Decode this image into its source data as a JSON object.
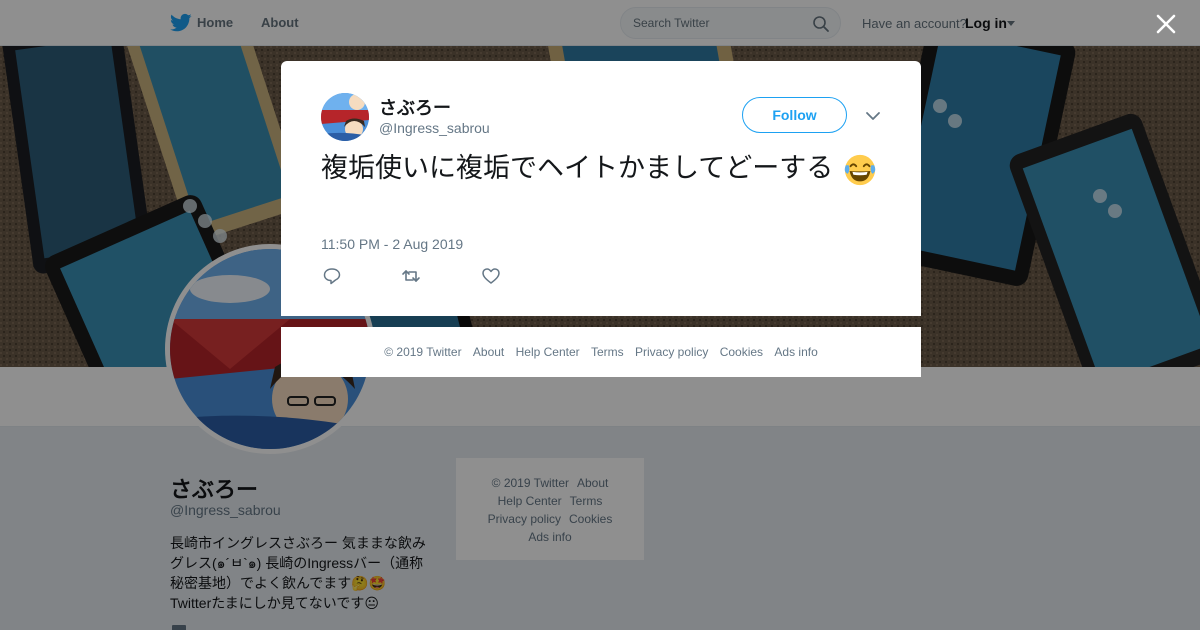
{
  "nav": {
    "home": "Home",
    "about": "About",
    "search_placeholder": "Search Twitter",
    "have_account": "Have an account?",
    "login": "Log in"
  },
  "profile": {
    "name": "さぶろー",
    "handle": "@Ingress_sabrou",
    "bio": "長崎市イングレスさぶろー 気ままな飲み\nグレス(๑´ㅂ`๑) 長崎のIngressバー（通称\n秘密基地）でよく飲んでます🤔🤩\nTwitterたまにしか見てないです😐"
  },
  "side_footer": {
    "copyright": "© 2019 Twitter",
    "about": "About",
    "help": "Help Center",
    "terms": "Terms",
    "privacy": "Privacy policy",
    "cookies": "Cookies",
    "ads": "Ads info"
  },
  "tweet": {
    "name": "さぶろー",
    "handle": "@Ingress_sabrou",
    "follow_label": "Follow",
    "text": "複垢使いに複垢でヘイトかましてどーする",
    "time": "11:50 PM - 2 Aug 2019"
  },
  "modal_footer": {
    "copyright": "© 2019 Twitter",
    "about": "About",
    "help": "Help Center",
    "terms": "Terms",
    "privacy": "Privacy policy",
    "cookies": "Cookies",
    "ads": "Ads info"
  },
  "colors": {
    "brand": "#1da1f2",
    "text": "#14171a",
    "secondary": "#657786",
    "page_bg": "#e6ecf0"
  },
  "icons": {
    "nav_logo": "twitter-bird-icon",
    "search": "search-icon",
    "close": "close-icon",
    "more": "chevron-down-icon",
    "reply": "reply-icon",
    "retweet": "retweet-icon",
    "like": "heart-icon"
  }
}
